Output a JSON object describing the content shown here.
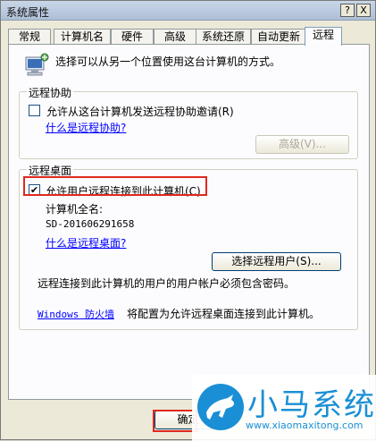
{
  "window": {
    "title": "系统属性",
    "help_button": "?",
    "close_button": "X"
  },
  "tabs": [
    {
      "label": "常规"
    },
    {
      "label": "计算机名"
    },
    {
      "label": "硬件"
    },
    {
      "label": "高级"
    },
    {
      "label": "系统还原"
    },
    {
      "label": "自动更新"
    },
    {
      "label": "远程"
    }
  ],
  "active_tab": "远程",
  "intro": {
    "text": "选择可以从另一个位置使用这台计算机的方式。",
    "icon": "computer-remote-icon"
  },
  "remote_assistance": {
    "legend": "远程协助",
    "checkbox_label": "允许从这台计算机发送远程协助邀请(R)",
    "checked": false,
    "link": "什么是远程协助?",
    "advanced_button": "高级(V)..."
  },
  "remote_desktop": {
    "legend": "远程桌面",
    "checkbox_label": "允许用户远程连接到此计算机(C)",
    "checked": true,
    "full_name_label": "计算机全名:",
    "full_name_value": "SD-201606291658",
    "link": "什么是远程桌面?",
    "select_users_button": "选择远程用户(S)...",
    "password_note": "远程连接到此计算机的用户的用户帐户必须包含密码。",
    "firewall_link": "Windows 防火墙",
    "firewall_text": "将配置为允许远程桌面连接到此计算机。"
  },
  "footer": {
    "ok_button": "确定"
  },
  "watermark": {
    "brand": "小马系统",
    "url": "www.xiaomaxitong.com",
    "logo_icon": "horse-logo-icon"
  },
  "colors": {
    "highlight": "#e0281e",
    "link": "#0000ff",
    "brand": "#1a8fd6"
  }
}
